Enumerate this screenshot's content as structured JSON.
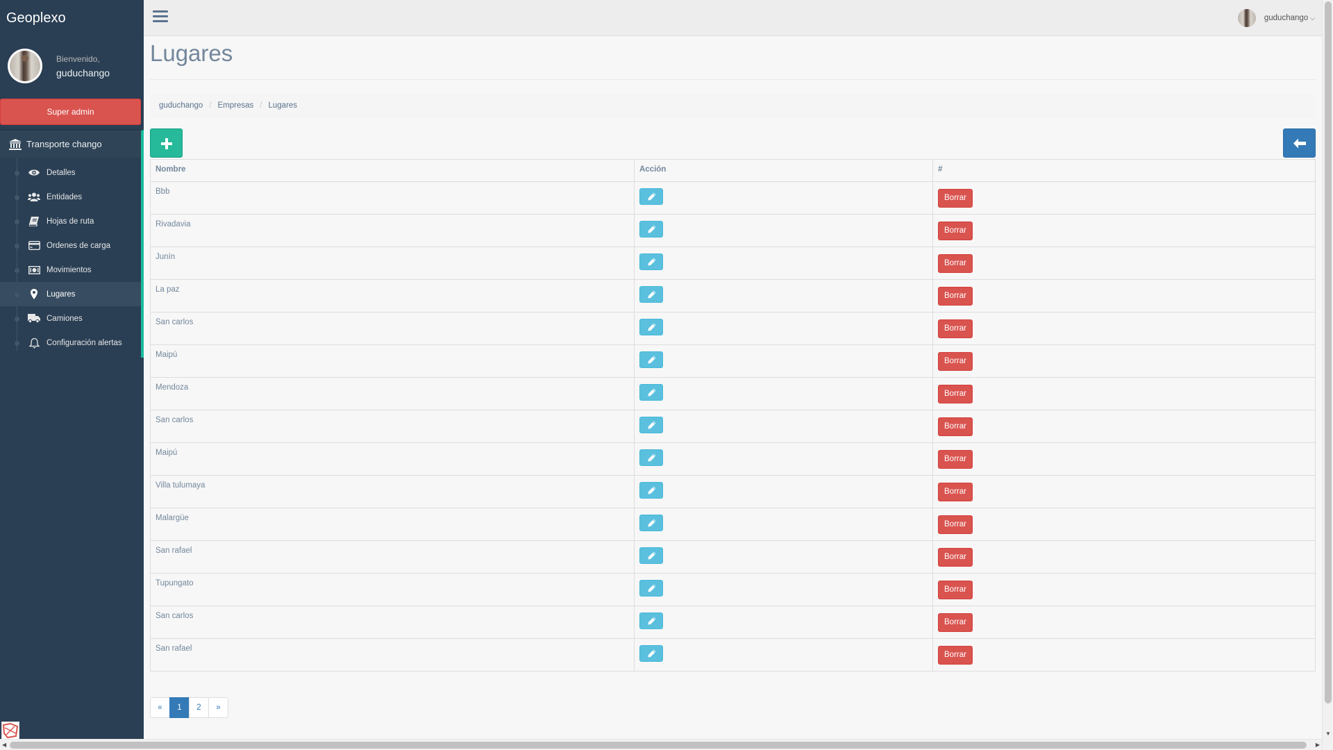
{
  "app": {
    "brand": "Geoplexo"
  },
  "profile": {
    "welcome": "Bienvenido,",
    "username": "guduchango"
  },
  "sidebar": {
    "super_admin_label": "Super admin",
    "company_label": "Transporte chango",
    "items": [
      {
        "label": "Detalles",
        "icon": "eye-icon"
      },
      {
        "label": "Entidades",
        "icon": "users-icon"
      },
      {
        "label": "Hojas de ruta",
        "icon": "book-icon"
      },
      {
        "label": "Ordenes de carga",
        "icon": "credit-card-icon"
      },
      {
        "label": "Movimientos",
        "icon": "money-icon"
      },
      {
        "label": "Lugares",
        "icon": "map-marker-icon",
        "active": true
      },
      {
        "label": "Camiones",
        "icon": "truck-icon"
      },
      {
        "label": "Configuración alertas",
        "icon": "bell-icon"
      }
    ]
  },
  "topnav": {
    "username": "guduchango"
  },
  "page": {
    "title": "Lugares"
  },
  "breadcrumb": [
    "guduchango",
    "Empresas",
    "Lugares"
  ],
  "table": {
    "headers": [
      "Nombre",
      "Acción",
      "#"
    ],
    "delete_label": "Borrar",
    "rows": [
      "Bbb",
      "Rivadavia",
      "Junín",
      "La paz",
      "San carlos",
      "Maipú",
      "Mendoza",
      "San carlos",
      "Maipú",
      "Villa tulumaya",
      "Malargüe",
      "San rafael",
      "Tupungato",
      "San carlos",
      "San rafael"
    ]
  },
  "pagination": {
    "prev": "«",
    "pages": [
      "1",
      "2"
    ],
    "current": "1",
    "next": "»"
  },
  "colors": {
    "sidebar": "#2a3f54",
    "accent_green": "#26b99a",
    "primary": "#337ab7",
    "danger": "#d9534f",
    "info": "#5bc0de"
  }
}
